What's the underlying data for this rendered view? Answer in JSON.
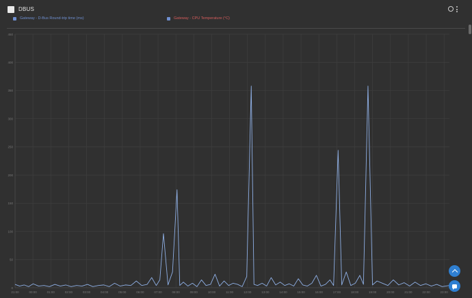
{
  "panel": {
    "title": "DBUS"
  },
  "legend": [
    {
      "label": "Gateway - D-Bus Round-trip time (ms)",
      "color": "#6f8fd0",
      "icon": "dashboard-tile-icon"
    },
    {
      "label": "Gateway - CPU Temperature (°C)",
      "color": "#d65d5d",
      "icon": "dashboard-tile-icon"
    }
  ],
  "colors": {
    "line": "#8fb0e6",
    "grid": "#3f3f3f",
    "axis_text": "#7a7a7a",
    "accent": "#2f7fd1"
  },
  "chart_data": {
    "type": "line",
    "ylim": [
      0,
      450
    ],
    "yticks": [
      "0",
      "50",
      "100",
      "150",
      "200",
      "250",
      "300",
      "350",
      "400",
      "450"
    ],
    "xticks": [
      "21:00",
      "00:00",
      "01:00",
      "02:00",
      "03:00",
      "04:00",
      "05:00",
      "06:00",
      "07:00",
      "08:00",
      "09:00",
      "10:00",
      "11:00",
      "12:00",
      "13:00",
      "14:00",
      "15:00",
      "16:00",
      "17:00",
      "18:00",
      "19:00",
      "20:00",
      "21:00",
      "22:00",
      "23:00"
    ],
    "xlim": [
      0,
      24
    ],
    "series": [
      {
        "name": "Gateway - D-Bus Round-trip time (ms)",
        "x": [
          0,
          0.25,
          0.5,
          0.75,
          1.0,
          1.3,
          1.6,
          1.9,
          2.2,
          2.5,
          2.8,
          3.1,
          3.4,
          3.7,
          4.0,
          4.3,
          4.6,
          4.9,
          5.2,
          5.5,
          5.8,
          6.1,
          6.4,
          6.7,
          7.0,
          7.3,
          7.55,
          7.8,
          8.0,
          8.2,
          8.45,
          8.7,
          8.95,
          9.1,
          9.3,
          9.55,
          9.8,
          10.05,
          10.3,
          10.55,
          10.8,
          11.05,
          11.3,
          11.55,
          11.8,
          12.05,
          12.3,
          12.55,
          12.8,
          13.05,
          13.2,
          13.4,
          13.65,
          13.9,
          14.15,
          14.4,
          14.65,
          14.9,
          15.15,
          15.4,
          15.65,
          15.9,
          16.15,
          16.4,
          16.65,
          16.9,
          17.15,
          17.4,
          17.6,
          17.85,
          18.05,
          18.3,
          18.55,
          18.8,
          19.05,
          19.25,
          19.5,
          19.75,
          20.0,
          20.3,
          20.6,
          20.9,
          21.2,
          21.5,
          21.8,
          22.1,
          22.4,
          22.7,
          23.0,
          23.3,
          23.6,
          24.0
        ],
        "values": [
          6,
          3,
          5,
          2,
          7,
          3,
          4,
          2,
          6,
          3,
          5,
          2,
          4,
          3,
          6,
          2,
          4,
          5,
          2,
          8,
          3,
          5,
          4,
          12,
          4,
          6,
          18,
          4,
          14,
          96,
          5,
          28,
          174,
          4,
          10,
          3,
          8,
          2,
          14,
          4,
          6,
          24,
          3,
          12,
          4,
          8,
          6,
          2,
          20,
          358,
          6,
          4,
          8,
          3,
          18,
          5,
          10,
          4,
          7,
          3,
          16,
          5,
          3,
          8,
          22,
          3,
          6,
          14,
          4,
          244,
          5,
          28,
          4,
          8,
          22,
          6,
          358,
          5,
          12,
          8,
          4,
          14,
          5,
          9,
          3,
          10,
          4,
          7,
          3,
          6,
          2,
          4
        ]
      }
    ]
  }
}
